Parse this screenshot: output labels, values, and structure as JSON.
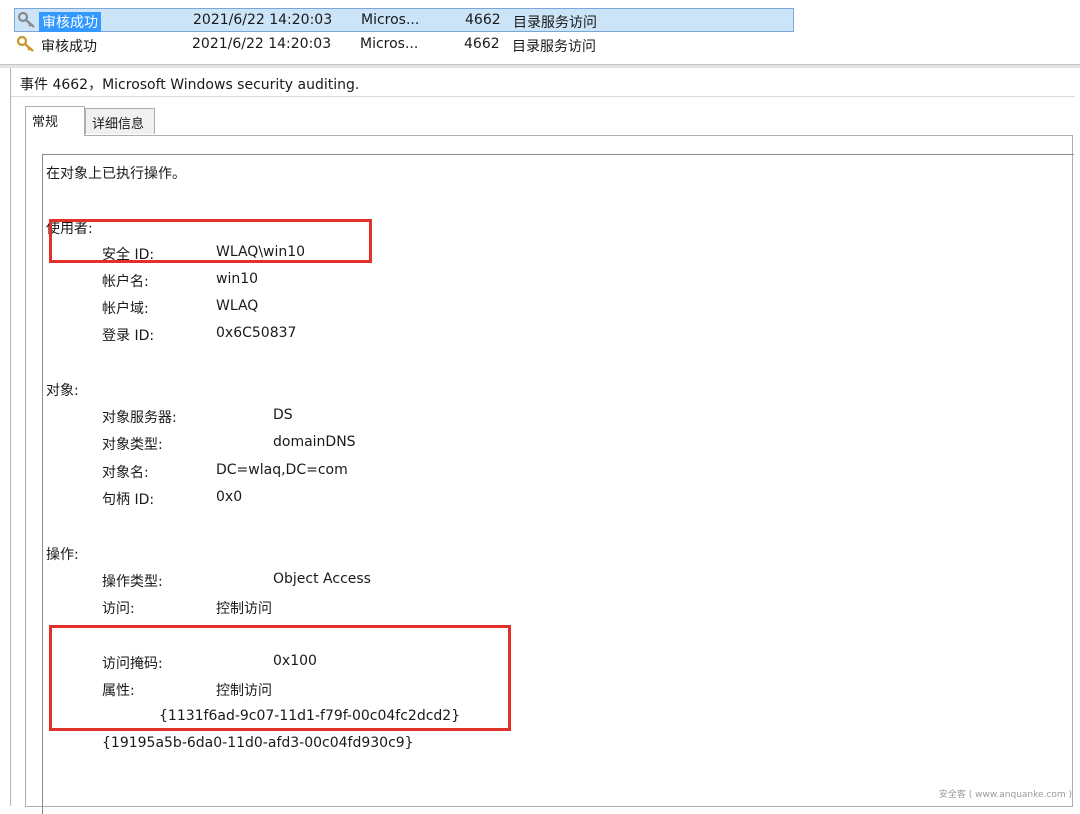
{
  "event_list": {
    "rows": [
      {
        "level": "审核成功",
        "datetime": "2021/6/22 14:20:03",
        "source": "Micros...",
        "event_id": "4662",
        "category": "目录服务访问",
        "selected": true
      },
      {
        "level": "审核成功",
        "datetime": "2021/6/22 14:20:03",
        "source": "Micros...",
        "event_id": "4662",
        "category": "目录服务访问",
        "selected": false
      }
    ]
  },
  "detail": {
    "title": "事件 4662，Microsoft Windows security auditing.",
    "tabs": [
      "常规",
      "详细信息"
    ],
    "active_tab": "常规",
    "description": "在对象上已执行操作。",
    "subject": {
      "header": "使用者:",
      "fields": [
        {
          "label": "安全 ID:",
          "value": "WLAQ\\win10"
        },
        {
          "label": "帐户名:",
          "value": "win10"
        },
        {
          "label": "帐户域:",
          "value": "WLAQ"
        },
        {
          "label": "登录 ID:",
          "value": "0x6C50837"
        }
      ]
    },
    "object": {
      "header": "对象:",
      "fields": [
        {
          "label": "对象服务器:",
          "value": "DS"
        },
        {
          "label": "对象类型:",
          "value": "domainDNS"
        },
        {
          "label": "对象名:",
          "value": "DC=wlaq,DC=com"
        },
        {
          "label": "句柄 ID:",
          "value": "0x0"
        }
      ]
    },
    "operation": {
      "header": "操作:",
      "fields": [
        {
          "label": "操作类型:",
          "value": "Object Access"
        },
        {
          "label": "访问:",
          "value": "控制访问"
        },
        {
          "label": "访问掩码:",
          "value": "0x100"
        },
        {
          "label": "属性:",
          "value": "控制访问"
        }
      ],
      "property_guids": [
        "{1131f6ad-9c07-11d1-f79f-00c04fc2dcd2}",
        "{19195a5b-6da0-11d0-afd3-00c04fd930c9}"
      ]
    }
  },
  "watermark": "安全客 ( www.anquanke.com )",
  "colors": {
    "highlight": "#e0322b",
    "selection": "#cce4f7",
    "selection_border": "#7aa7d8"
  }
}
